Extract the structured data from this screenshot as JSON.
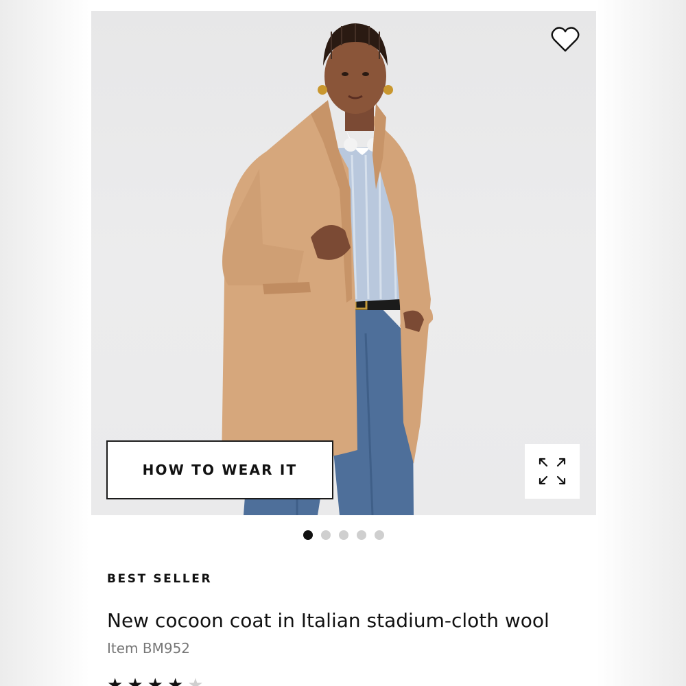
{
  "product": {
    "badge": "BEST SELLER",
    "title": "New cocoon coat in Italian stadium-cloth wool",
    "item_number": "Item BM952",
    "rating": {
      "filled": 4,
      "total": 5
    }
  },
  "gallery": {
    "how_to_wear_label": "HOW TO WEAR IT",
    "current_image": 1,
    "image_count": 5,
    "icons": {
      "favorite": "heart-outline-icon",
      "expand": "expand-arrows-icon"
    }
  },
  "colors": {
    "coat": "#d6a77c",
    "denim": "#4e6f9a",
    "shirt": "#b9c8dd",
    "background": "#eaeaeb",
    "active_dot": "#111111",
    "inactive_dot": "#cfcfcf"
  }
}
